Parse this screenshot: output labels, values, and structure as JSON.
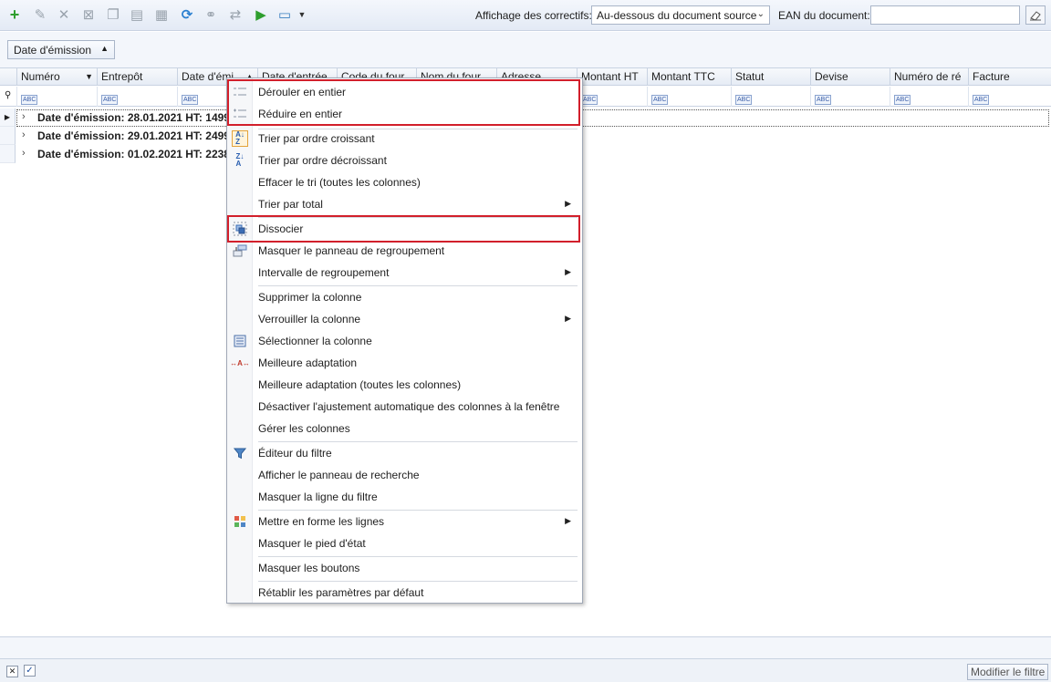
{
  "toolbar": {
    "buttons": [
      "add-icon",
      "edit-icon",
      "delete-icon",
      "cancel-icon",
      "copy-icon",
      "print-icon",
      "calendar-icon",
      "refresh-icon",
      "link-icon",
      "transfer-icon",
      "run-icon",
      "view-icon",
      "more-arrow-icon"
    ],
    "correctifs_label": "Affichage des correctifs:",
    "correctifs_value": "Au-dessous du document source",
    "ean_label": "EAN du document:",
    "ean_value": ""
  },
  "group_panel": {
    "chip_label": "Date d'émission"
  },
  "columns": [
    {
      "label": "Numéro"
    },
    {
      "label": "Entrepôt"
    },
    {
      "label": "Date d'émi"
    },
    {
      "label": "Date d'entrée"
    },
    {
      "label": "Code du four"
    },
    {
      "label": "Nom du four"
    },
    {
      "label": "Adresse"
    },
    {
      "label": "Montant HT"
    },
    {
      "label": "Montant TTC"
    },
    {
      "label": "Statut"
    },
    {
      "label": "Devise"
    },
    {
      "label": "Numéro de ré"
    },
    {
      "label": "Facture"
    }
  ],
  "filter_placeholder": "ABC",
  "groups": [
    {
      "text": "Date d'émission: 28.01.2021 HT: 1499,94,"
    },
    {
      "text": "Date d'émission: 29.01.2021 HT: 2499,90,"
    },
    {
      "text": "Date d'émission: 01.02.2021 HT: 2238,28,"
    }
  ],
  "context_menu": {
    "items": [
      {
        "label": "Dérouler en entier",
        "icon": "expand-all-icon"
      },
      {
        "label": "Réduire en entier",
        "icon": "collapse-all-icon"
      },
      {
        "label": "Trier par ordre croissant",
        "icon": "sort-ascending-icon"
      },
      {
        "label": "Trier par ordre décroissant",
        "icon": "sort-descending-icon"
      },
      {
        "label": "Effacer le tri (toutes les colonnes)"
      },
      {
        "label": "Trier par total"
      },
      {
        "label": "Dissocier",
        "icon": "ungroup-icon"
      },
      {
        "label": "Masquer le panneau de regroupement",
        "icon": "group-panel-icon"
      },
      {
        "label": "Intervalle de regroupement"
      },
      {
        "label": "Supprimer la colonne"
      },
      {
        "label": "Verrouiller la colonne"
      },
      {
        "label": "Sélectionner la colonne",
        "icon": "select-column-icon"
      },
      {
        "label": "Meilleure adaptation",
        "icon": "best-fit-icon"
      },
      {
        "label": "Meilleure adaptation (toutes les colonnes)"
      },
      {
        "label": "Désactiver l'ajustement automatique des colonnes à la fenêtre"
      },
      {
        "label": "Gérer les colonnes"
      },
      {
        "label": "Éditeur du filtre",
        "icon": "filter-icon"
      },
      {
        "label": "Afficher le panneau de recherche"
      },
      {
        "label": "Masquer la ligne du filtre"
      },
      {
        "label": "Mettre en forme les lignes",
        "icon": "format-rows-icon"
      },
      {
        "label": "Masquer le pied d'état"
      },
      {
        "label": "Masquer les boutons"
      },
      {
        "label": "Rétablir les paramètres par défaut"
      }
    ]
  },
  "footer": {
    "modify_filter_label": "Modifier le filtre"
  },
  "colors": {
    "highlight": "#d21f2b",
    "accent": "#3b5ea8"
  }
}
